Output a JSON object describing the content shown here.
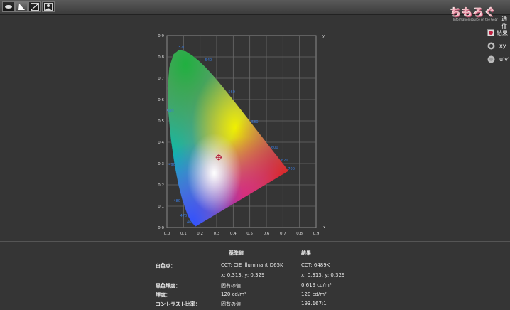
{
  "toolbar": {
    "tools": [
      {
        "name": "eye-tool",
        "active": false
      },
      {
        "name": "gamut-tool",
        "active": true
      },
      {
        "name": "gamma-tool",
        "active": false
      },
      {
        "name": "photo-tool",
        "active": false
      }
    ]
  },
  "logo": {
    "text": "ちもろぐ",
    "sub": "Information source on the Gear",
    "suffix": "通信"
  },
  "right_panel": {
    "result_label": "結果",
    "options": [
      {
        "label": "xy",
        "selected": true
      },
      {
        "label": "u'v'",
        "selected": false
      }
    ]
  },
  "chart_data": {
    "type": "scatter",
    "title": "",
    "xlabel": "x",
    "ylabel": "y",
    "xlim": [
      0,
      0.9
    ],
    "ylim": [
      0,
      0.9
    ],
    "grid": true,
    "x_ticks": [
      "0.0",
      "0.1",
      "0.2",
      "0.3",
      "0.4",
      "0.5",
      "0.6",
      "0.7",
      "0.8",
      "0.9"
    ],
    "y_ticks": [
      "0.0",
      "0.1",
      "0.2",
      "0.3",
      "0.4",
      "0.5",
      "0.6",
      "0.7",
      "0.8",
      "0.9"
    ],
    "wavelength_labels": [
      {
        "label": "520",
        "x": 0.07,
        "y": 0.84
      },
      {
        "label": "540",
        "x": 0.23,
        "y": 0.78
      },
      {
        "label": "560",
        "x": 0.37,
        "y": 0.63
      },
      {
        "label": "580",
        "x": 0.51,
        "y": 0.49
      },
      {
        "label": "600",
        "x": 0.63,
        "y": 0.37
      },
      {
        "label": "620",
        "x": 0.69,
        "y": 0.31
      },
      {
        "label": "700",
        "x": 0.73,
        "y": 0.27
      },
      {
        "label": "500",
        "x": 0.0,
        "y": 0.54
      },
      {
        "label": "490",
        "x": 0.01,
        "y": 0.29
      },
      {
        "label": "480",
        "x": 0.04,
        "y": 0.12
      },
      {
        "label": "470",
        "x": 0.08,
        "y": 0.05
      },
      {
        "label": "460",
        "x": 0.12,
        "y": 0.02
      }
    ],
    "white_point": {
      "x": 0.313,
      "y": 0.329
    }
  },
  "table": {
    "headers": [
      "基準値",
      "結果"
    ],
    "rows": [
      {
        "label": "白色点：",
        "ref": "CCT: CIE Illuminant D65K",
        "result": "CCT: 6489K"
      },
      {
        "label": "",
        "ref": "x: 0.313, y: 0.329",
        "result": "x: 0.313, y: 0.329"
      },
      {
        "label": "黒色輝度：",
        "ref": "固有の値",
        "result": "0.619 cd/m²"
      },
      {
        "label": "輝度：",
        "ref": "120 cd/m²",
        "result": "120 cd/m²"
      },
      {
        "label": "コントラスト比率：",
        "ref": "固有の値",
        "result": "193.167:1"
      }
    ]
  }
}
